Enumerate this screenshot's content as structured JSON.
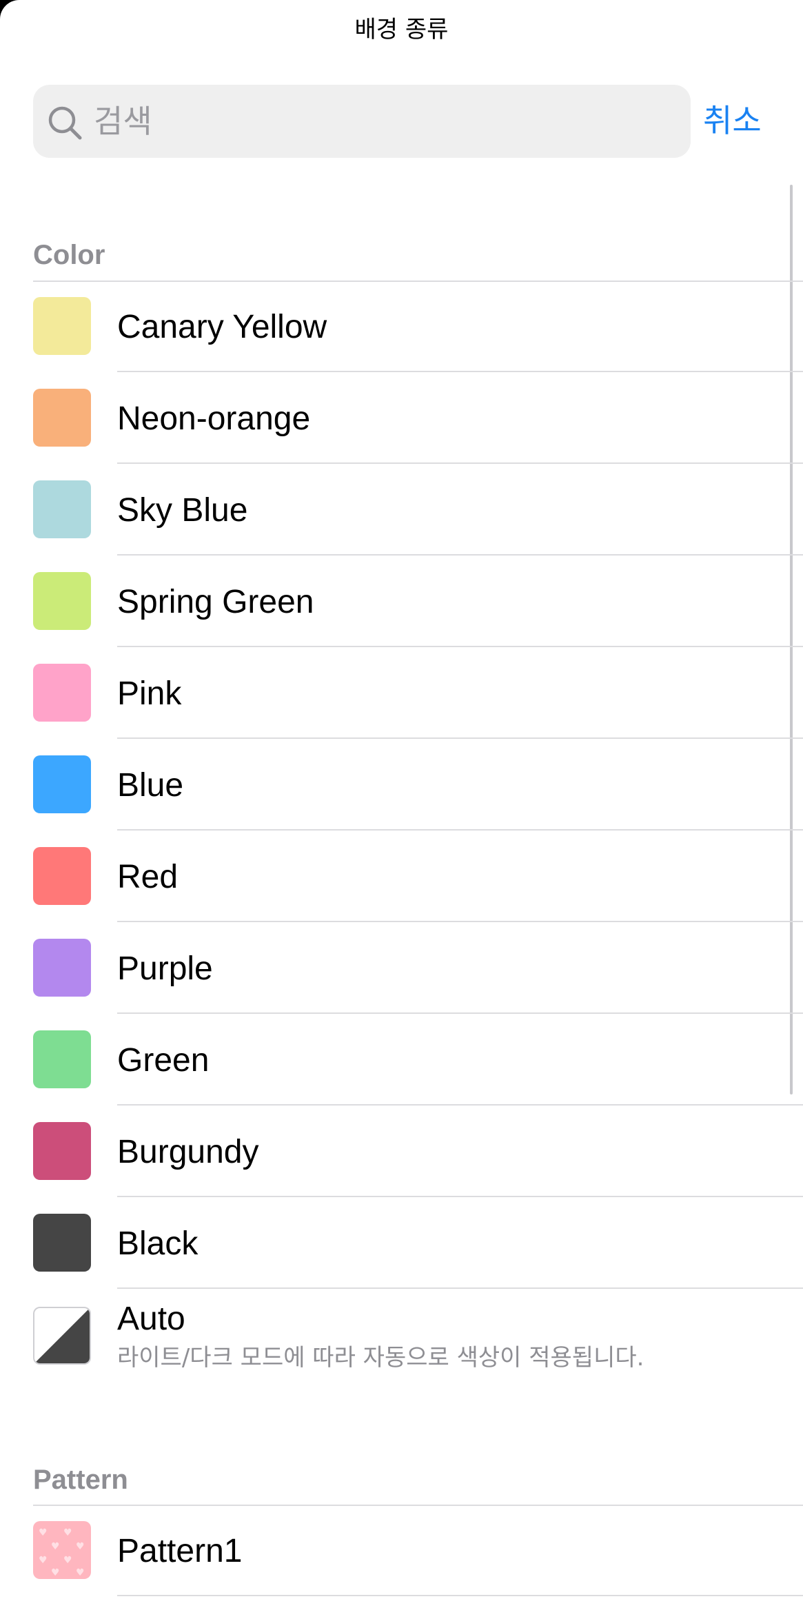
{
  "header": {
    "title": "배경 종류"
  },
  "search": {
    "placeholder": "검색",
    "cancel_label": "취소"
  },
  "sections": {
    "color": {
      "title": "Color",
      "items": [
        {
          "label": "Canary Yellow",
          "color": "#F3EA9A"
        },
        {
          "label": "Neon-orange",
          "color": "#F9B07A"
        },
        {
          "label": "Sky Blue",
          "color": "#ADD9DE"
        },
        {
          "label": "Spring Green",
          "color": "#CBEB78"
        },
        {
          "label": "Pink",
          "color": "#FFA3C9"
        },
        {
          "label": "Blue",
          "color": "#3CA7FF"
        },
        {
          "label": "Red",
          "color": "#FF7878"
        },
        {
          "label": "Purple",
          "color": "#B388EE"
        },
        {
          "label": "Green",
          "color": "#7EDD92"
        },
        {
          "label": "Burgundy",
          "color": "#CC4E7A"
        },
        {
          "label": "Black",
          "color": "#454545"
        }
      ],
      "auto": {
        "label": "Auto",
        "description": "라이트/다크 모드에 따라 자동으로 색상이 적용됩니다.",
        "icon": "light-dark-split-icon"
      }
    },
    "pattern": {
      "title": "Pattern",
      "items": [
        {
          "label": "Pattern1",
          "color": "#FFB6BF",
          "icon": "heart-pattern-icon"
        }
      ]
    }
  }
}
